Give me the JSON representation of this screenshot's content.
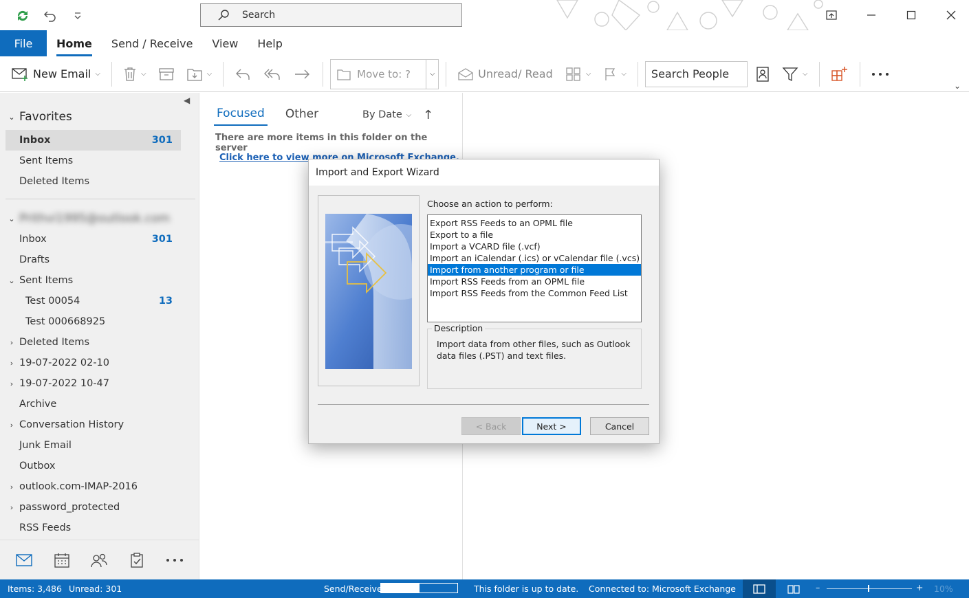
{
  "titlebar": {
    "search_placeholder": "Search"
  },
  "ribbon_tabs": [
    "File",
    "Home",
    "Send / Receive",
    "View",
    "Help"
  ],
  "ribbon": {
    "new_email": "New Email",
    "move_to": "Move to: ?",
    "unread_read": "Unread/ Read",
    "search_people": "Search People"
  },
  "folders": {
    "favorites_label": "Favorites",
    "favorites": [
      {
        "label": "Inbox",
        "count": "301"
      },
      {
        "label": "Sent Items",
        "count": ""
      },
      {
        "label": "Deleted Items",
        "count": ""
      }
    ],
    "account_label": "Prithvi1995@outlook.com",
    "inbox": {
      "label": "Inbox",
      "count": "301"
    },
    "drafts": "Drafts",
    "sent_items": "Sent Items",
    "test1": {
      "label": "Test 00054",
      "count": "13"
    },
    "test2": "Test 000668925",
    "deleted_items": "Deleted Items",
    "date1": "19-07-2022 02-10",
    "date2": "19-07-2022 10-47",
    "archive": "Archive",
    "conversation_history": "Conversation History",
    "junk": "Junk Email",
    "outbox": "Outbox",
    "imap": "outlook.com-IMAP-2016",
    "password_protected": "password_protected",
    "rss": "RSS Feeds"
  },
  "message_list": {
    "tab_focused": "Focused",
    "tab_other": "Other",
    "sort": "By Date",
    "info": "There are more items in this folder on the server",
    "link": "Click here to view more on Microsoft Exchange."
  },
  "dialog": {
    "title": "Import and Export Wizard",
    "prompt": "Choose an action to perform:",
    "options": [
      "Export RSS Feeds to an OPML file",
      "Export to a file",
      "Import a VCARD file (.vcf)",
      "Import an iCalendar (.ics) or vCalendar file (.vcs)",
      "Import from another program or file",
      "Import RSS Feeds from an OPML file",
      "Import RSS Feeds from the Common Feed List"
    ],
    "selected_index": 4,
    "description_label": "Description",
    "description": "Import data from other files, such as Outlook data files (.PST) and text files.",
    "back": "< Back",
    "next": "Next >",
    "cancel": "Cancel"
  },
  "statusbar": {
    "items": "Items: 3,486",
    "unread": "Unread: 301",
    "send_receive": "Send/Receive",
    "progress": 0.5,
    "folder_status": "This folder is up to date.",
    "connection": "Connected to: Microsoft Exchange",
    "zoom": "10%"
  },
  "colors": {
    "accent": "#0f6cbd",
    "selection": "#0078d7"
  }
}
